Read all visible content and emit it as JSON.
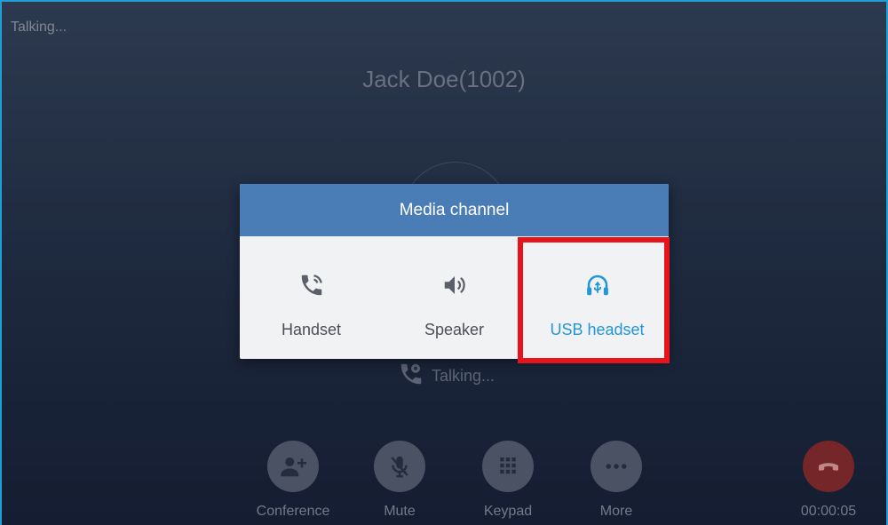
{
  "status_bar": {
    "state_text": "Talking..."
  },
  "call": {
    "caller_name": "Jack Doe(1002)",
    "status_text": "Talking...",
    "duration": "00:00:05"
  },
  "controls": {
    "conference_label": "Conference",
    "mute_label": "Mute",
    "keypad_label": "Keypad",
    "more_label": "More"
  },
  "dialog": {
    "title": "Media channel",
    "options": [
      {
        "label": "Handset",
        "icon": "handset-icon",
        "selected": false
      },
      {
        "label": "Speaker",
        "icon": "speaker-icon",
        "selected": false
      },
      {
        "label": "USB headset",
        "icon": "usb-headset-icon",
        "selected": true
      }
    ]
  },
  "colors": {
    "header": "#4a7cb6",
    "selected": "#2196d9",
    "highlight": "#e8141c",
    "end_call": "#8c2b2b"
  }
}
